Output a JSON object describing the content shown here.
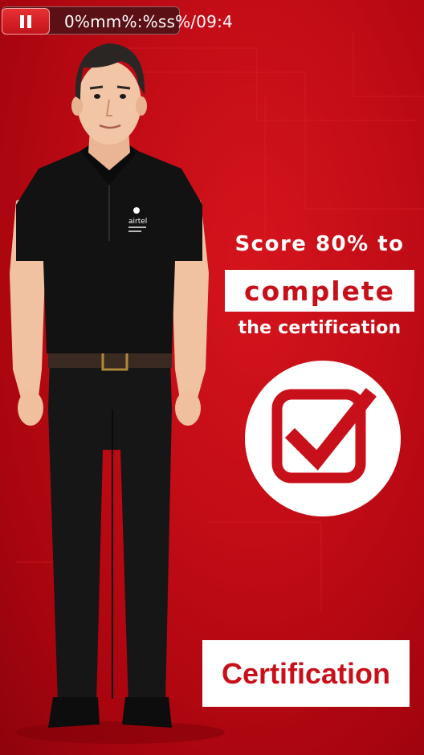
{
  "player": {
    "time_display": "0%mm%:%ss%/09:4",
    "pause_icon": "pause-icon"
  },
  "overlay": {
    "score_text": "Score 80% to",
    "highlight_text": "complete",
    "subtitle_text": "the certification",
    "badge_text": "Certification",
    "check_icon": "checkbox-check-icon"
  },
  "character": {
    "shirt_logo": "airtel"
  },
  "colors": {
    "brand_red": "#c8101a",
    "background_red": "#c20c16",
    "white": "#ffffff"
  }
}
